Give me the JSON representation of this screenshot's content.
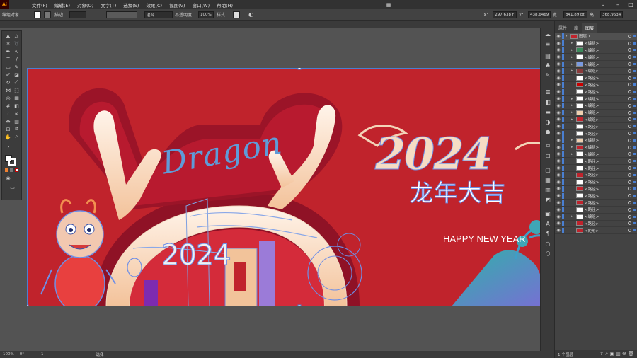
{
  "menu": {
    "logo": "Ai",
    "items": [
      "文件(F)",
      "编辑(E)",
      "对象(O)",
      "文字(T)",
      "选择(S)",
      "效果(C)",
      "视图(V)",
      "窗口(W)",
      "帮助(H)"
    ]
  },
  "control_bar": {
    "selection": "编组对象",
    "stroke_label": "描边：",
    "blend_mode": "混合",
    "opacity_label": "不透明度：",
    "opacity_value": "100%",
    "style_label": "样式：",
    "x_label": "X：",
    "x_value": "297.638 r",
    "y_label": "Y：",
    "y_value": "438.6469",
    "w_label": "宽：",
    "w_value": "841.89 pt",
    "h_label": "高：",
    "h_value": "368.9634"
  },
  "artwork": {
    "dragon_script": "Dragon",
    "year_big": "2024",
    "year_mid": "2024",
    "chinese_slogan": "龙年大吉",
    "english_slogan": "HAPPY NEW YEAR"
  },
  "status_bar": {
    "zoom": "100%",
    "rotation": "0°",
    "artboard_num": "1",
    "tool": "选择"
  },
  "layers_panel": {
    "tabs": [
      "属性",
      "库",
      "图层"
    ],
    "active_tab": "图层",
    "top_layer": "图层 1",
    "rows": [
      {
        "name": "<编组>",
        "has_arrow": true
      },
      {
        "name": "<编组>",
        "has_arrow": true
      },
      {
        "name": "<编组>",
        "has_arrow": true
      },
      {
        "name": "<编组>",
        "has_arrow": true
      },
      {
        "name": "<编组>",
        "has_arrow": true
      },
      {
        "name": "<路径>",
        "has_arrow": false
      },
      {
        "name": "<路径>",
        "has_arrow": false
      },
      {
        "name": "<路径>",
        "has_arrow": false
      },
      {
        "name": "<编组>",
        "has_arrow": true
      },
      {
        "name": "<编组>",
        "has_arrow": true
      },
      {
        "name": "<编组>",
        "has_arrow": true
      },
      {
        "name": "<编组>",
        "has_arrow": true
      },
      {
        "name": "<路径>",
        "has_arrow": false
      },
      {
        "name": "<路径>",
        "has_arrow": false
      },
      {
        "name": "<编组>",
        "has_arrow": true
      },
      {
        "name": "<编组>",
        "has_arrow": true
      },
      {
        "name": "<编组>",
        "has_arrow": true
      },
      {
        "name": "<路径>",
        "has_arrow": false
      },
      {
        "name": "<路径>",
        "has_arrow": false
      },
      {
        "name": "<路径>",
        "has_arrow": false
      },
      {
        "name": "<路径>",
        "has_arrow": false
      },
      {
        "name": "<路径>",
        "has_arrow": false
      },
      {
        "name": "<路径>",
        "has_arrow": false
      },
      {
        "name": "<路径>",
        "has_arrow": false
      },
      {
        "name": "<路径>",
        "has_arrow": false
      },
      {
        "name": "<编组>",
        "has_arrow": true
      },
      {
        "name": "<路径>",
        "has_arrow": false
      },
      {
        "name": "<矩形>",
        "has_arrow": false
      }
    ],
    "footer_text": "1 个图层"
  },
  "colors": {
    "artboard_red": "#c0232c",
    "selection_blue": "#4a7fd1"
  }
}
